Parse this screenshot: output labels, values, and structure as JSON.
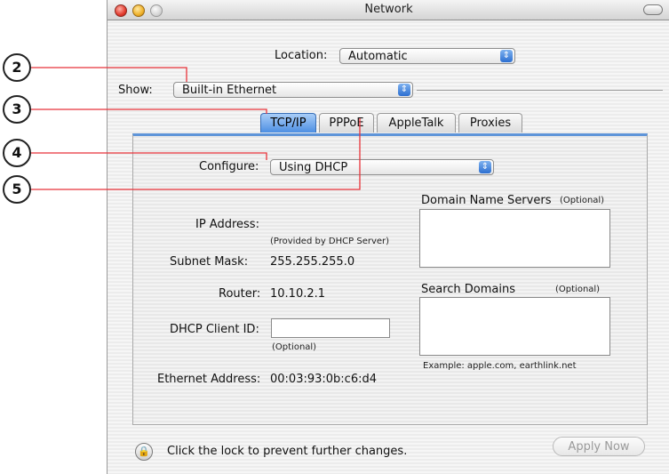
{
  "window": {
    "title": "Network"
  },
  "location": {
    "label": "Location:",
    "value": "Automatic"
  },
  "show": {
    "label": "Show:",
    "value": "Built-in Ethernet"
  },
  "tabs": [
    {
      "label": "TCP/IP",
      "active": true
    },
    {
      "label": "PPPoE",
      "active": false
    },
    {
      "label": "AppleTalk",
      "active": false
    },
    {
      "label": "Proxies",
      "active": false
    }
  ],
  "configure": {
    "label": "Configure:",
    "value": "Using DHCP"
  },
  "fields": {
    "ip_label": "IP Address:",
    "ip_note": "(Provided by DHCP Server)",
    "subnet_label": "Subnet Mask:",
    "subnet_value": "255.255.255.0",
    "router_label": "Router:",
    "router_value": "10.10.2.1",
    "dhcp_client_label": "DHCP Client ID:",
    "dhcp_client_value": "",
    "dhcp_client_note": "(Optional)",
    "ethernet_label": "Ethernet Address:",
    "ethernet_value": "00:03:93:0b:c6:d4"
  },
  "dns": {
    "label": "Domain Name Servers",
    "optional": "(Optional)"
  },
  "search_domains": {
    "label": "Search Domains",
    "optional": "(Optional)",
    "example": "Example: apple.com, earthlink.net"
  },
  "footer": {
    "lock_text": "Click the lock to prevent further changes.",
    "apply_label": "Apply Now"
  },
  "callouts": [
    "2",
    "3",
    "4",
    "5"
  ],
  "colors": {
    "callout_line": "#e8333a",
    "tab_active": "#4d8fe3",
    "popup_arrow": "#2c6fd1"
  },
  "icons": {
    "lock": "lock-icon",
    "popup_arrow": "up-down-arrow-icon"
  }
}
